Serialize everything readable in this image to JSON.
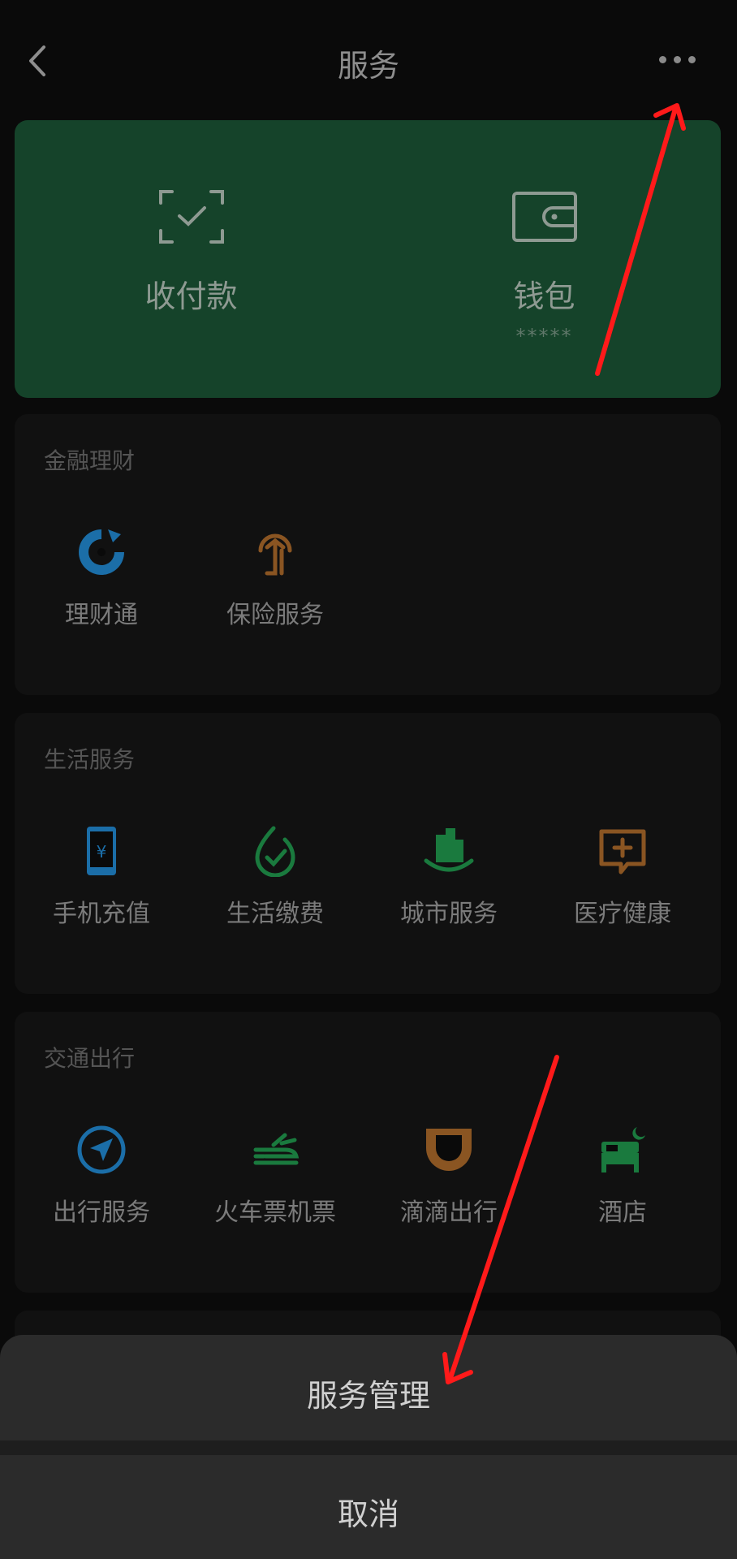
{
  "nav": {
    "title": "服务",
    "back_icon": "back-chevron-icon",
    "more_icon": "more-dots-icon"
  },
  "wallet_card": {
    "pay": {
      "label": "收付款",
      "icon": "scan-check-icon"
    },
    "wallet": {
      "label": "钱包",
      "balance": "*****",
      "icon": "wallet-icon"
    },
    "bg_color": "#15432a"
  },
  "sections": [
    {
      "title": "金融理财",
      "items": [
        {
          "label": "理财通",
          "icon": "wealth-icon",
          "color": "#1b6ea8"
        },
        {
          "label": "保险服务",
          "icon": "insurance-icon",
          "color": "#8a5522"
        }
      ]
    },
    {
      "title": "生活服务",
      "items": [
        {
          "label": "手机充值",
          "icon": "phone-topup-icon",
          "color": "#1b6ea8"
        },
        {
          "label": "生活缴费",
          "icon": "utility-payment-icon",
          "color": "#1a7a3e"
        },
        {
          "label": "城市服务",
          "icon": "city-service-icon",
          "color": "#1a7a3e"
        },
        {
          "label": "医疗健康",
          "icon": "medical-icon",
          "color": "#8a5522"
        }
      ]
    },
    {
      "title": "交通出行",
      "items": [
        {
          "label": "出行服务",
          "icon": "navigation-icon",
          "color": "#1b6ea8"
        },
        {
          "label": "火车票机票",
          "icon": "train-plane-icon",
          "color": "#1a7a3e"
        },
        {
          "label": "滴滴出行",
          "icon": "didi-icon",
          "color": "#8a5522"
        },
        {
          "label": "酒店",
          "icon": "hotel-icon",
          "color": "#1a7a3e"
        }
      ]
    }
  ],
  "action_sheet": {
    "primary": "服务管理",
    "cancel": "取消"
  },
  "annotations": {
    "arrow_color": "#ff1a1a"
  }
}
